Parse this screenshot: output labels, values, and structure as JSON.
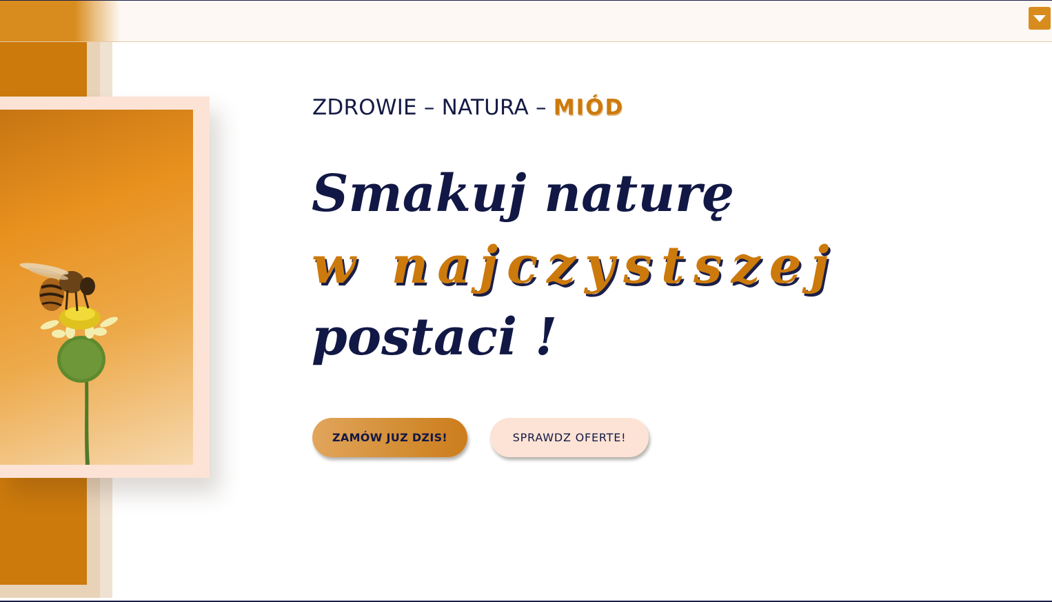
{
  "header": {
    "menu_icon": "caret-down-icon",
    "brand_color": "#d98c1e"
  },
  "hero": {
    "tagline_part1": "ZDROWIE – NATURA – ",
    "tagline_accent": "MIÓD",
    "headline_line1": "Smakuj naturę",
    "headline_line2": "w najczystszej",
    "headline_line3": "postaci !",
    "image_alt": "bee-on-flower-photo"
  },
  "buttons": {
    "primary_label": "ZAMÓW JUZ DZIS!",
    "secondary_label": "SPRAWDZ OFERTE!"
  },
  "colors": {
    "accent": "#cc7a0c",
    "navy": "#121845",
    "peach": "#fce3d5"
  }
}
